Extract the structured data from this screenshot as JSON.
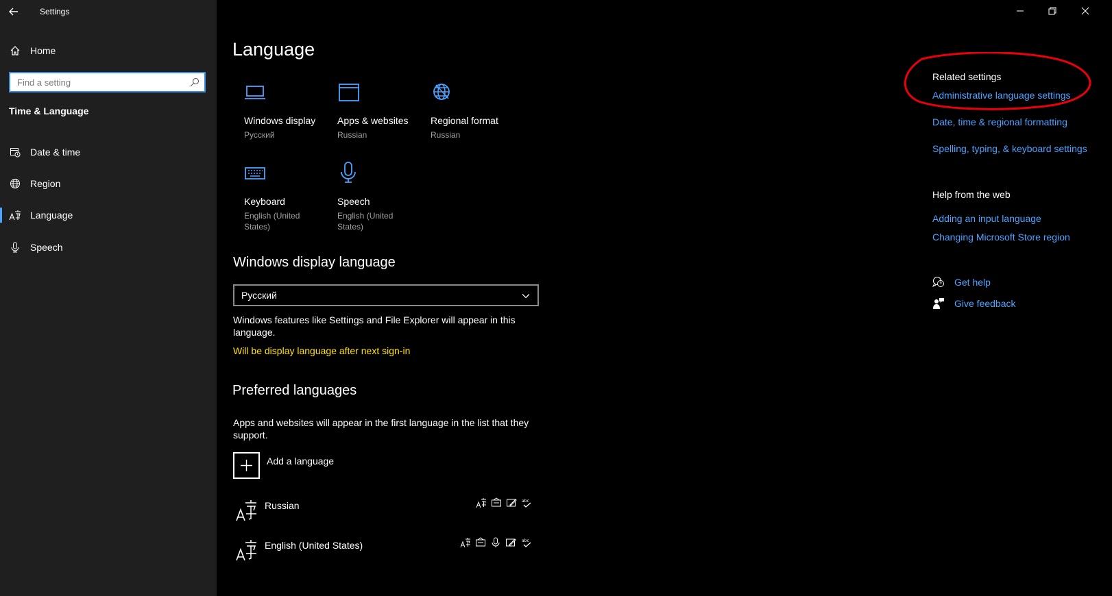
{
  "window": {
    "title": "Settings"
  },
  "sidebar": {
    "home": "Home",
    "search_placeholder": "Find a setting",
    "section": "Time & Language",
    "items": [
      {
        "label": "Date & time",
        "icon": "calendar-clock-icon"
      },
      {
        "label": "Region",
        "icon": "globe-icon"
      },
      {
        "label": "Language",
        "icon": "language-icon",
        "active": true
      },
      {
        "label": "Speech",
        "icon": "microphone-icon"
      }
    ]
  },
  "main": {
    "title": "Language",
    "tiles": [
      {
        "label": "Windows display",
        "value": "Русский",
        "icon": "monitor-icon"
      },
      {
        "label": "Apps & websites",
        "value": "Russian",
        "icon": "window-icon"
      },
      {
        "label": "Regional format",
        "value": "Russian",
        "icon": "globe-icon"
      },
      {
        "label": "Keyboard",
        "value": "English (United States)",
        "icon": "keyboard-icon"
      },
      {
        "label": "Speech",
        "value": "English (United States)",
        "icon": "microphone-icon"
      }
    ],
    "display_language": {
      "heading": "Windows display language",
      "selected": "Русский",
      "description": "Windows features like Settings and File Explorer will appear in this language.",
      "notice": "Will be display language after next sign-in"
    },
    "preferred": {
      "heading": "Preferred languages",
      "description": "Apps and websites will appear in the first language in the list that they support.",
      "add_label": "Add a language",
      "languages": [
        {
          "name": "Russian"
        },
        {
          "name": "English (United States)"
        }
      ]
    }
  },
  "related": {
    "heading": "Related settings",
    "links": [
      "Administrative language settings",
      "Date, time & regional formatting",
      "Spelling, typing, & keyboard settings"
    ]
  },
  "help": {
    "heading": "Help from the web",
    "links": [
      "Adding an input language",
      "Changing Microsoft Store region"
    ],
    "get_help": "Get help",
    "give_feedback": "Give feedback"
  },
  "colors": {
    "accent": "#4ca3ff",
    "warning": "#ffe100",
    "annotation": "#e8000b",
    "sidebar_bg": "#1f1f1f"
  }
}
